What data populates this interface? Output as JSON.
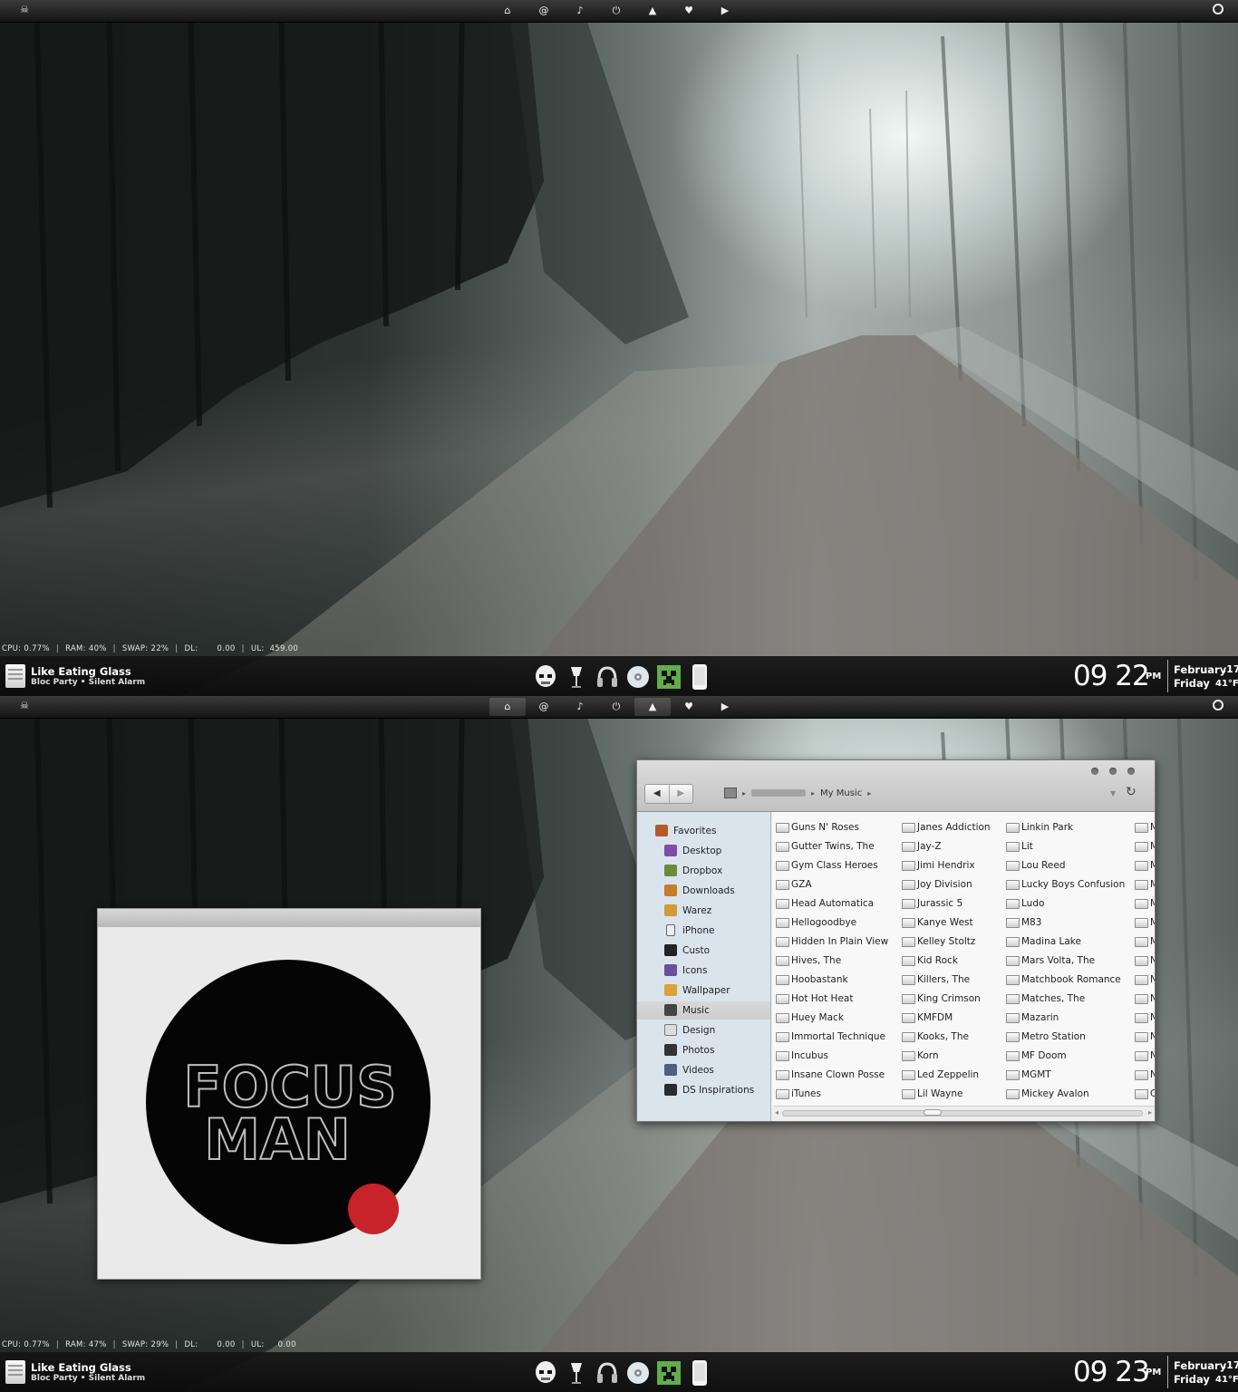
{
  "topbar": {
    "skull_icon": "skull-icon",
    "icons": [
      "home-icon",
      "at-icon",
      "music-note-icon",
      "plug-icon",
      "photo-icon",
      "heart-icon",
      "play-icon"
    ],
    "glyphs": [
      "⌂",
      "@",
      "♪",
      "⏻",
      "▲",
      "♥",
      "▶"
    ],
    "power_icon": "power-icon"
  },
  "screens": [
    {
      "stats": {
        "cpu_label": "CPU:",
        "cpu": "0.77%",
        "ram_label": "RAM:",
        "ram": "40%",
        "swap_label": "SWAP:",
        "swap": "22%",
        "dl_label": "DL:",
        "dl": "0.00",
        "ul_label": "UL:",
        "ul": "459.00"
      },
      "clock": {
        "time": "09 22",
        "ampm": "PM",
        "month": "February",
        "date": ".17",
        "day": "Friday",
        "temp": "41°F"
      }
    },
    {
      "stats": {
        "cpu_label": "CPU:",
        "cpu": "0.77%",
        "ram_label": "RAM:",
        "ram": "47%",
        "swap_label": "SWAP:",
        "swap": "29%",
        "dl_label": "DL:",
        "dl": "0.00",
        "ul_label": "UL:",
        "ul": "0.00"
      },
      "clock": {
        "time": "09 23",
        "ampm": "PM",
        "month": "February",
        "date": ".17",
        "day": "Friday",
        "temp": "41°F"
      }
    }
  ],
  "now_playing": {
    "title": "Like Eating Glass",
    "artist": "Bloc Party • Silent Alarm"
  },
  "dock": [
    "stormtrooper-icon",
    "lamp-icon",
    "headphones-icon",
    "disc-icon",
    "creeper-icon",
    "phone-icon"
  ],
  "album": {
    "text_line1": "FOCUS",
    "text_line2": "MAN",
    "accent_red": "#c8232a"
  },
  "finder": {
    "breadcrumb_current": "My Music",
    "nav_back": "◀",
    "nav_forward": "▶",
    "refresh": "↻",
    "sidebar_header": "Favorites",
    "sidebar_items": [
      "Desktop",
      "Dropbox",
      "Downloads",
      "Warez",
      "iPhone",
      "Custo",
      "Icons",
      "Wallpaper",
      "Music",
      "Design",
      "Photos",
      "Videos",
      "DS Inspirations"
    ],
    "selected_item": "Music",
    "columns": [
      [
        "Guns N' Roses",
        "Gutter Twins, The",
        "Gym Class Heroes",
        "GZA",
        "Head Automatica",
        "Hellogoodbye",
        "Hidden In Plain View",
        "Hives, The",
        "Hoobastank",
        "Hot Hot Heat",
        "Huey Mack",
        "Immortal Technique",
        "Incubus",
        "Insane Clown Posse",
        "iTunes"
      ],
      [
        "Janes Addiction",
        "Jay-Z",
        "Jimi Hendrix",
        "Joy Division",
        "Jurassic 5",
        "Kanye West",
        "Kelley Stoltz",
        "Kid Rock",
        "Killers, The",
        "King Crimson",
        "KMFDM",
        "Kooks, The",
        "Korn",
        "Led Zeppelin",
        "Lil Wayne"
      ],
      [
        "Linkin Park",
        "Lit",
        "Lou Reed",
        "Lucky Boys Confusion",
        "Ludo",
        "M83",
        "Madina Lake",
        "Mars Volta, The",
        "Matchbook Romance",
        "Matches, The",
        "Mazarin",
        "Metro Station",
        "MF Doom",
        "MGMT",
        "Mickey Avalon"
      ],
      [
        "M",
        "M",
        "M",
        "M",
        "M",
        "M",
        "M",
        "N",
        "N",
        "N",
        "N",
        "N",
        "N",
        "N",
        "C"
      ]
    ]
  },
  "colors": {
    "sidebar_bg": "#dae4ec",
    "bar_bg": "#151515"
  }
}
